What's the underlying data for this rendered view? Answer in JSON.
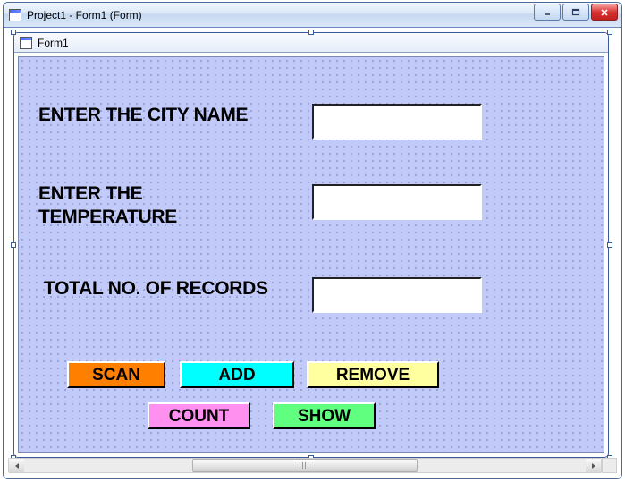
{
  "outer": {
    "title": "Project1 - Form1 (Form)"
  },
  "inner": {
    "title": "Form1"
  },
  "labels": {
    "city": "ENTER THE CITY NAME",
    "temp": "ENTER THE TEMPERATURE",
    "total": "TOTAL NO. OF RECORDS"
  },
  "inputs": {
    "city": "",
    "temp": "",
    "total": ""
  },
  "buttons": {
    "scan": "SCAN",
    "add": "ADD",
    "remove": "REMOVE",
    "count": "COUNT",
    "show": "SHOW"
  },
  "colors": {
    "scan": "#ff7f00",
    "add": "#00ffff",
    "remove": "#ffffa0",
    "count": "#ff90f0",
    "show": "#60ff80"
  }
}
